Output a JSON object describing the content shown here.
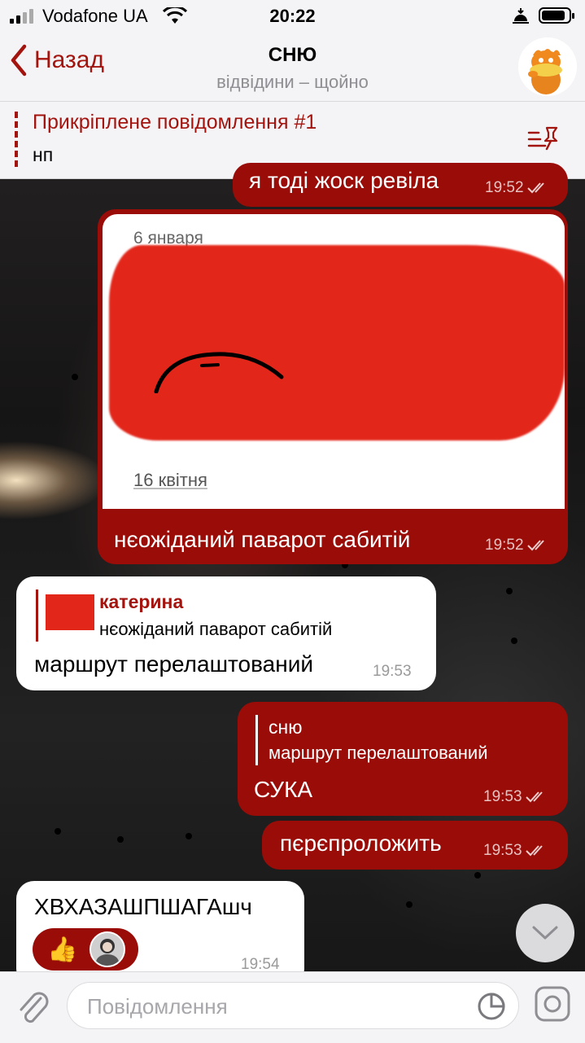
{
  "status_bar": {
    "carrier": "Vodafone UA",
    "time": "20:22"
  },
  "header": {
    "back_label": "Назад",
    "title": "СНЮ",
    "subtitle": "відвідини – щойно"
  },
  "pinned": {
    "title": "Прикріплене повідомлення #1",
    "text": "нп"
  },
  "messages": [
    {
      "text": "я тоді жоск ревіла",
      "time": "19:52"
    },
    {
      "image_date_top": "6 января",
      "image_date_bottom": "16 квітня",
      "text": "нєожіданий паварот сабитій",
      "time": "19:52"
    },
    {
      "reply_name": "катерина",
      "reply_text": "нєожіданий паварот сабитій",
      "text": "маршрут перелаштований",
      "time": "19:53"
    },
    {
      "reply_name": "сню",
      "reply_text": "маршрут перелаштований",
      "text": "СУКА",
      "time": "19:53"
    },
    {
      "text": "пєрєпроложить",
      "time": "19:53"
    },
    {
      "text": "ХВХАЗАШПШАГАшч",
      "time": "19:54",
      "reaction": "👍"
    }
  ],
  "input": {
    "placeholder": "Повідомлення"
  },
  "colors": {
    "accent": "#a3140f",
    "outgoing_bubble": "#9a0c08",
    "incoming_bubble": "#ffffff"
  }
}
